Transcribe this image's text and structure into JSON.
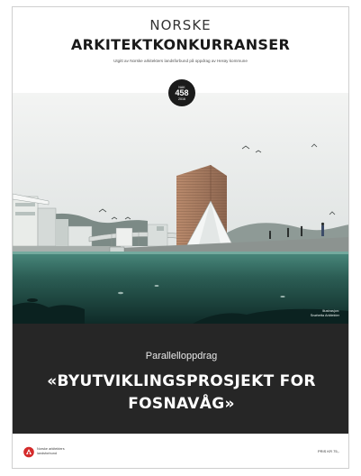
{
  "masthead": {
    "title_top": "NORSKE",
    "title_main": "ARKITEKTKONKURRANSER",
    "subtitle": "Utgitt av Norske arkitekters landsforbund på oppdrag av Herøy kommune"
  },
  "issue": {
    "prefix": "NAK",
    "number": "458",
    "year": "2016"
  },
  "illustration": {
    "credit_line1": "Illustrasjon:",
    "credit_line2": "Snøhetta Arkitekter"
  },
  "feature": {
    "kicker": "Parallelloppdrag",
    "title_line1": "«BYUTVIKLINGSPROSJEKT FOR",
    "title_line2": "FOSNAVÅG»"
  },
  "footer": {
    "publisher_line1": "Norske arkitekters",
    "publisher_line2": "landsforbund",
    "price": "PRIS KR 75,-"
  },
  "colors": {
    "band": "#262626",
    "water_top": "#3f7d72",
    "water_deep": "#10302c",
    "logo_red": "#d42b2b"
  }
}
